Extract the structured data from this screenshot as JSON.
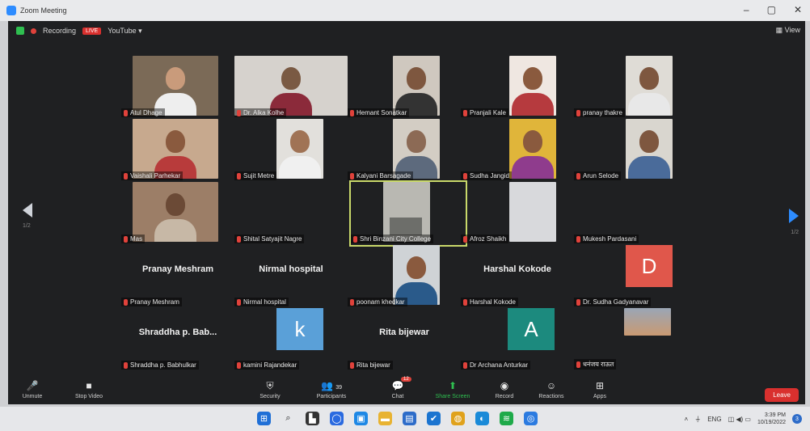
{
  "window": {
    "title": "Zoom Meeting",
    "minimize": "–",
    "maximize": "▢",
    "close": "✕"
  },
  "topbar": {
    "recording": "Recording",
    "live": "LIVE",
    "youtube": "YouTube ▾",
    "view": "View"
  },
  "colors": {
    "accent": "#2d8cff",
    "live": "#d9302e",
    "active_border": "#c9d96a",
    "green": "#2fbf50"
  },
  "nav": {
    "prev_page": "1/2",
    "next_page": "1/2"
  },
  "participants": [
    {
      "name": "Atul Dhage"
    },
    {
      "name": "Dr. Alka Kolhe"
    },
    {
      "name": "Hemant Sonatkar"
    },
    {
      "name": "Pranjali Kale"
    },
    {
      "name": "pranay thakre"
    },
    {
      "name": "Vaishali Parhekar"
    },
    {
      "name": "Sujit Metre"
    },
    {
      "name": "Kalyani Barsagade"
    },
    {
      "name": "Sudha Jangid"
    },
    {
      "name": "Arun Selode"
    },
    {
      "name": "Mas"
    },
    {
      "name": "Shital Satyajit Nagre"
    },
    {
      "name": "Shri Binzani City College"
    },
    {
      "name": "Afroz Shaikh"
    },
    {
      "name": "Mukesh Pardasani"
    },
    {
      "name": "Pranay Meshram",
      "display": "Pranay Meshram"
    },
    {
      "name": "Nirmal hospital",
      "display": "Nirmal hospital"
    },
    {
      "name": "poonam khedkar"
    },
    {
      "name": "Harshal Kokode",
      "display": "Harshal Kokode"
    },
    {
      "name": "Dr. Sudha Gadyanavar",
      "initial": "D"
    },
    {
      "name": "Shraddha p. Babhulkar",
      "display": "Shraddha p. Bab..."
    },
    {
      "name": "kamini Rajandekar",
      "initial": "k"
    },
    {
      "name": "Rita bijewar",
      "display": "Rita bijewar"
    },
    {
      "name": "Dr Archana Anturkar",
      "initial": "A"
    },
    {
      "name": "धनंजय राऊत"
    }
  ],
  "toolbar": {
    "unmute": "Unmute",
    "stop_video": "Stop Video",
    "security": "Security",
    "participants": "Participants",
    "participants_count": "39",
    "chat": "Chat",
    "chat_badge": "12",
    "share_screen": "Share Screen",
    "record": "Record",
    "reactions": "Reactions",
    "apps": "Apps",
    "leave": "Leave"
  },
  "taskbar": {
    "lang": "ENG",
    "time": "3:39 PM",
    "date": "10/19/2022",
    "notif": "3"
  }
}
